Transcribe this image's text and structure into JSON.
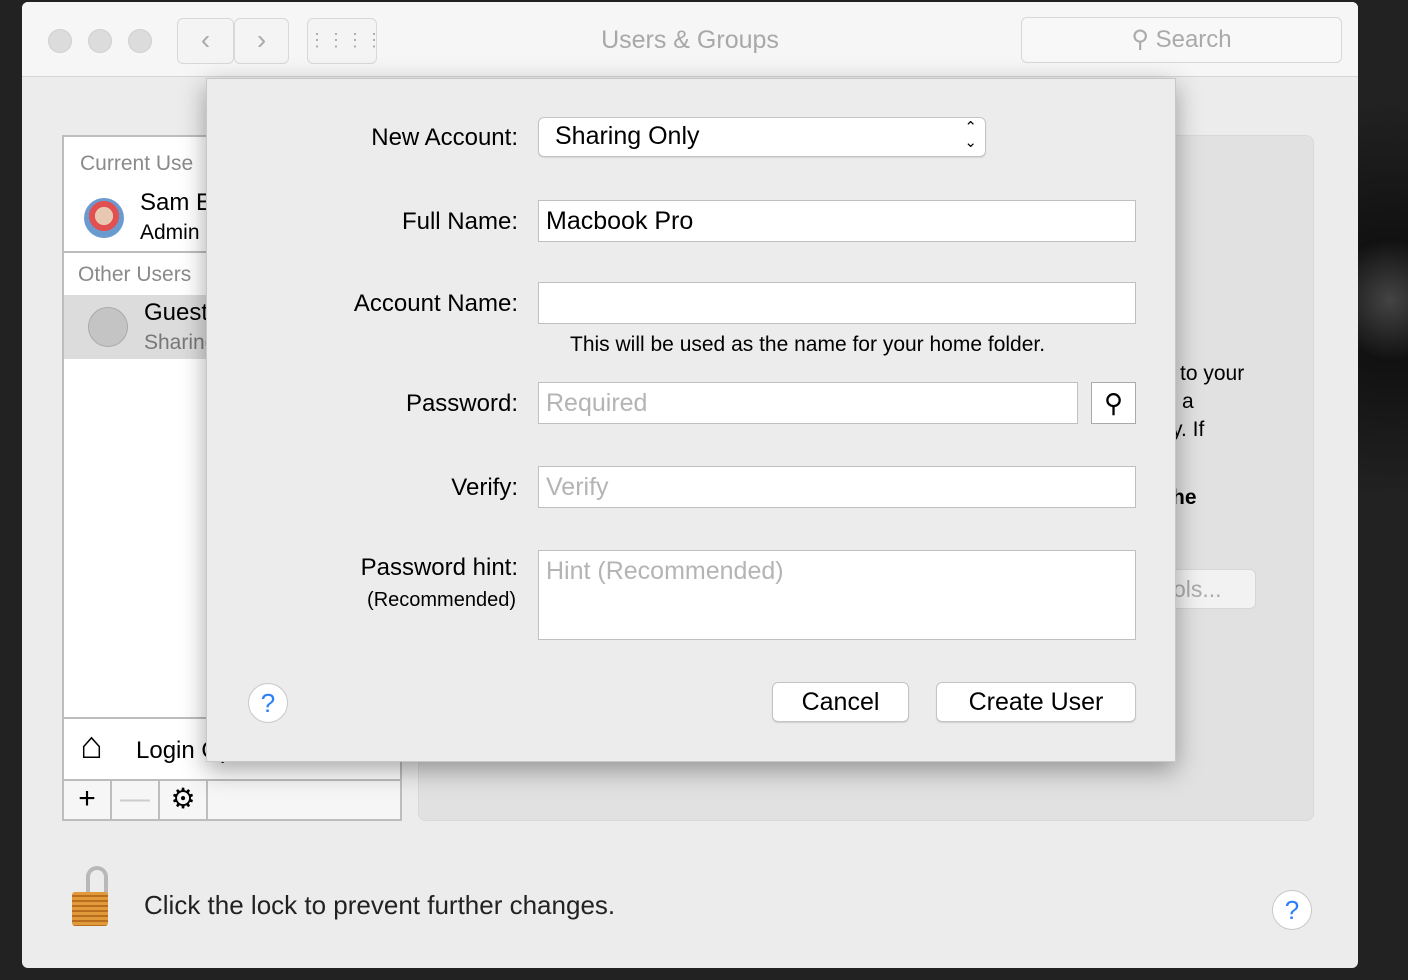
{
  "window": {
    "title": "Users & Groups",
    "search_placeholder": "Search"
  },
  "sidebar": {
    "current_users_header": "Current Use",
    "current_user": {
      "name": "Sam E",
      "role": "Admin"
    },
    "other_users_header": "Other Users",
    "other_user": {
      "name": "Guest User",
      "role": "Sharing"
    },
    "login_options": "Login Options"
  },
  "background_panel": {
    "text_lines": [
      "to your",
      "a",
      "y. If"
    ],
    "bold_fragment": "he",
    "button_fragment": "ols..."
  },
  "lock": {
    "text": "Click the lock to prevent further changes."
  },
  "sheet": {
    "new_account_label": "New Account:",
    "new_account_value": "Sharing Only",
    "full_name_label": "Full Name:",
    "full_name_value": "Macbook Pro",
    "account_name_label": "Account Name:",
    "account_name_value": "",
    "account_name_hint": "This will be used as the name for your home folder.",
    "password_label": "Password:",
    "password_placeholder": "Required",
    "verify_label": "Verify:",
    "verify_placeholder": "Verify",
    "hint_label": "Password hint:",
    "hint_sublabel": "(Recommended)",
    "hint_placeholder": "Hint (Recommended)",
    "cancel": "Cancel",
    "create": "Create User",
    "help": "?"
  },
  "help": "?"
}
